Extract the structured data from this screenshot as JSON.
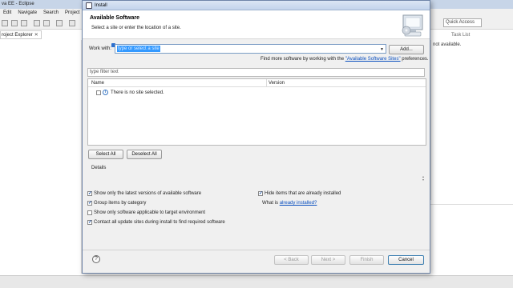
{
  "background": {
    "window_title": "va EE - Eclipse",
    "menu": [
      "Edit",
      "Navigate",
      "Search",
      "Project"
    ],
    "project_tab": "roject Explorer",
    "quick_access": "Quick Access",
    "task_list": "Task List",
    "right_panel_text": "not available."
  },
  "dialog": {
    "title": "Install",
    "header_title": "Available Software",
    "header_subtitle": "Select a site or enter the location of a site.",
    "work_with_label": "Work with:",
    "work_with_placeholder": "type or select a site",
    "add_button": "Add...",
    "find_more_prefix": "Find more software by working with the",
    "find_more_link": "\"Available Software Sites\"",
    "find_more_suffix": "preferences.",
    "filter_placeholder": "type filter text",
    "table": {
      "columns": [
        "Name",
        "Version"
      ],
      "rows": [
        {
          "text": "There is no site selected.",
          "checked": false
        }
      ]
    },
    "select_all": "Select All",
    "deselect_all": "Deselect All",
    "details_label": "Details",
    "options": {
      "latest_versions": {
        "label": "Show only the latest versions of available software",
        "checked": true
      },
      "group_by_category": {
        "label": "Group items by category",
        "checked": true
      },
      "target_env": {
        "label": "Show only software applicable to target environment",
        "checked": false
      },
      "contact_sites": {
        "label": "Contact all update sites during install to find required software",
        "checked": true
      },
      "hide_installed": {
        "label": "Hide items that are already installed",
        "checked": true
      },
      "already_installed_prefix": "What is",
      "already_installed_link": "already installed",
      "already_installed_suffix": "?"
    },
    "buttons": {
      "back": "< Back",
      "next": "Next >",
      "finish": "Finish",
      "cancel": "Cancel"
    }
  }
}
